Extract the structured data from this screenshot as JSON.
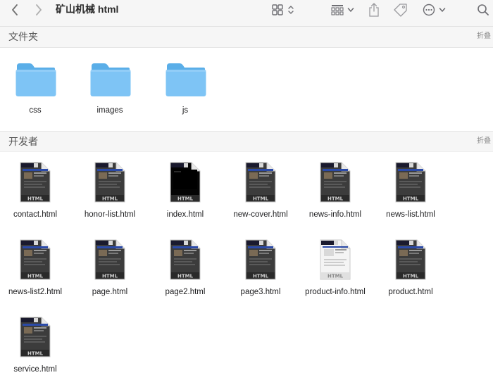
{
  "toolbar": {
    "title": "矿山机械 html",
    "icons": [
      "chevron-left-icon",
      "chevron-right-icon",
      "grid-view-icon",
      "up-down-chevron-icon",
      "group-by-icon",
      "chevron-down-icon",
      "share-icon",
      "tag-icon",
      "ellipsis-circle-icon",
      "chevron-down-icon",
      "search-icon"
    ]
  },
  "sections": {
    "folders": {
      "title": "文件夹",
      "collapse_label": "折叠"
    },
    "developer": {
      "title": "开发者",
      "collapse_label": "折叠"
    }
  },
  "folders": [
    {
      "name": "css"
    },
    {
      "name": "images"
    },
    {
      "name": "js"
    }
  ],
  "files": [
    {
      "name": "contact.html",
      "thumbnail_style": "dark-grey"
    },
    {
      "name": "honor-list.html",
      "thumbnail_style": "dark-grey"
    },
    {
      "name": "index.html",
      "thumbnail_style": "black"
    },
    {
      "name": "new-cover.html",
      "thumbnail_style": "dark-grey"
    },
    {
      "name": "news-info.html",
      "thumbnail_style": "dark-grey"
    },
    {
      "name": "news-list.html",
      "thumbnail_style": "dark-grey"
    },
    {
      "name": "news-list2.html",
      "thumbnail_style": "dark-grey"
    },
    {
      "name": "page.html",
      "thumbnail_style": "dark-grey"
    },
    {
      "name": "page2.html",
      "thumbnail_style": "dark-grey"
    },
    {
      "name": "page3.html",
      "thumbnail_style": "dark-grey"
    },
    {
      "name": "product-info.html",
      "thumbnail_style": "light"
    },
    {
      "name": "product.html",
      "thumbnail_style": "dark-grey"
    },
    {
      "name": "service.html",
      "thumbnail_style": "dark-grey"
    }
  ],
  "colors": {
    "folder_body": "#7ec4f5",
    "folder_tab": "#5aaee8",
    "accent_blue": "#2b4aa8"
  }
}
